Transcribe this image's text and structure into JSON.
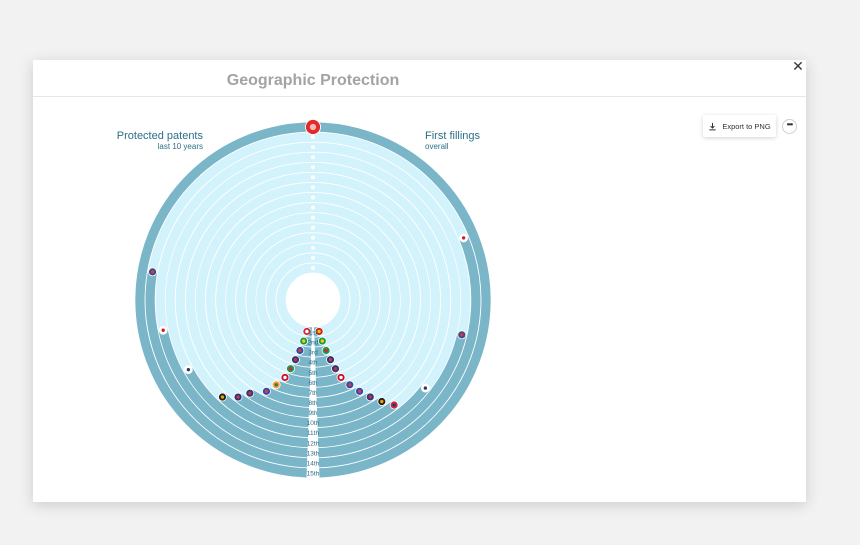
{
  "title": "Geographic Protection",
  "export_label": "Export to PNG",
  "icons": {
    "close": "close-icon",
    "export": "download-icon",
    "more": "more-icon"
  },
  "colors": {
    "ring_light": "#d2f2fc",
    "ring_dark": "#7ab5c8",
    "text": "#2c6f88",
    "title": "#a3a3a3"
  },
  "chart_data": {
    "type": "radial-bar",
    "ranks": [
      "15th",
      "14th",
      "13th",
      "12th",
      "11th",
      "10th",
      "9th",
      "8th",
      "7th",
      "6th",
      "5th",
      "4th",
      "3rd",
      "2nd",
      "1st"
    ],
    "series": [
      {
        "name": "Protected patents",
        "subtitle": "last 10 years",
        "side": "left",
        "countries": [
          "Austria",
          "Brazil",
          "Russia",
          "United Kingdom",
          "Italy",
          "Denmark",
          "India",
          "France",
          "United Kingdom",
          "Australia",
          "Germany",
          "South Korea",
          "Japan",
          "United States",
          "China"
        ],
        "values": [
          0.05,
          0.06,
          0.07,
          0.08,
          0.09,
          0.1,
          0.12,
          0.14,
          0.18,
          0.2,
          0.23,
          0.33,
          0.43,
          0.55,
          1.0
        ]
      },
      {
        "name": "First fillings",
        "subtitle": "overall",
        "side": "right",
        "countries": [
          "Spain",
          "Brazil",
          "Italy",
          "Australia",
          "United Kingdom",
          "Denmark",
          "Russia",
          "France",
          "United Kingdom",
          "Germany",
          "Taiwan",
          "South Korea",
          "United States",
          "Japan",
          "China"
        ],
        "values": [
          0.05,
          0.06,
          0.07,
          0.08,
          0.09,
          0.1,
          0.12,
          0.14,
          0.16,
          0.18,
          0.2,
          0.28,
          0.42,
          0.62,
          1.0
        ]
      }
    ]
  }
}
